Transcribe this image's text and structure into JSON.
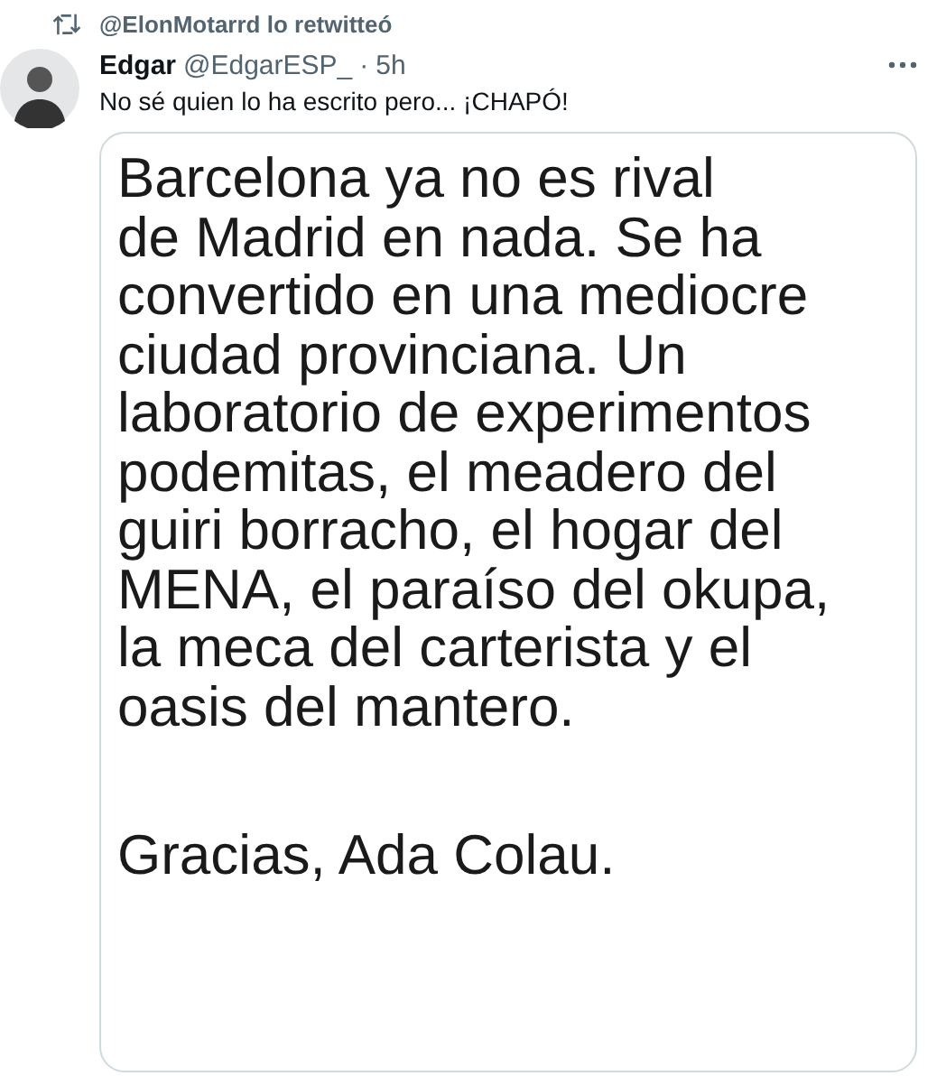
{
  "retweet": {
    "text": "@ElonMotarrd lo retwitteó"
  },
  "tweet": {
    "name": "Edgar",
    "handle": "@EdgarESP_",
    "separator": "·",
    "time": "5h",
    "text": "No sé quien lo ha escrito pero... ¡CHAPÓ!"
  },
  "image": {
    "paragraphs": [
      [
        "Barcelona ya no es rival",
        "de Madrid en nada. Se ha",
        "convertido en una mediocre",
        "ciudad provinciana. Un",
        "laboratorio de experimentos",
        "podemitas, el meadero del",
        "guiri borracho, el hogar del",
        "MENA, el paraíso del okupa,",
        "la meca del carterista y el",
        "oasis del mantero."
      ],
      [
        "Gracias, Ada Colau."
      ]
    ]
  }
}
